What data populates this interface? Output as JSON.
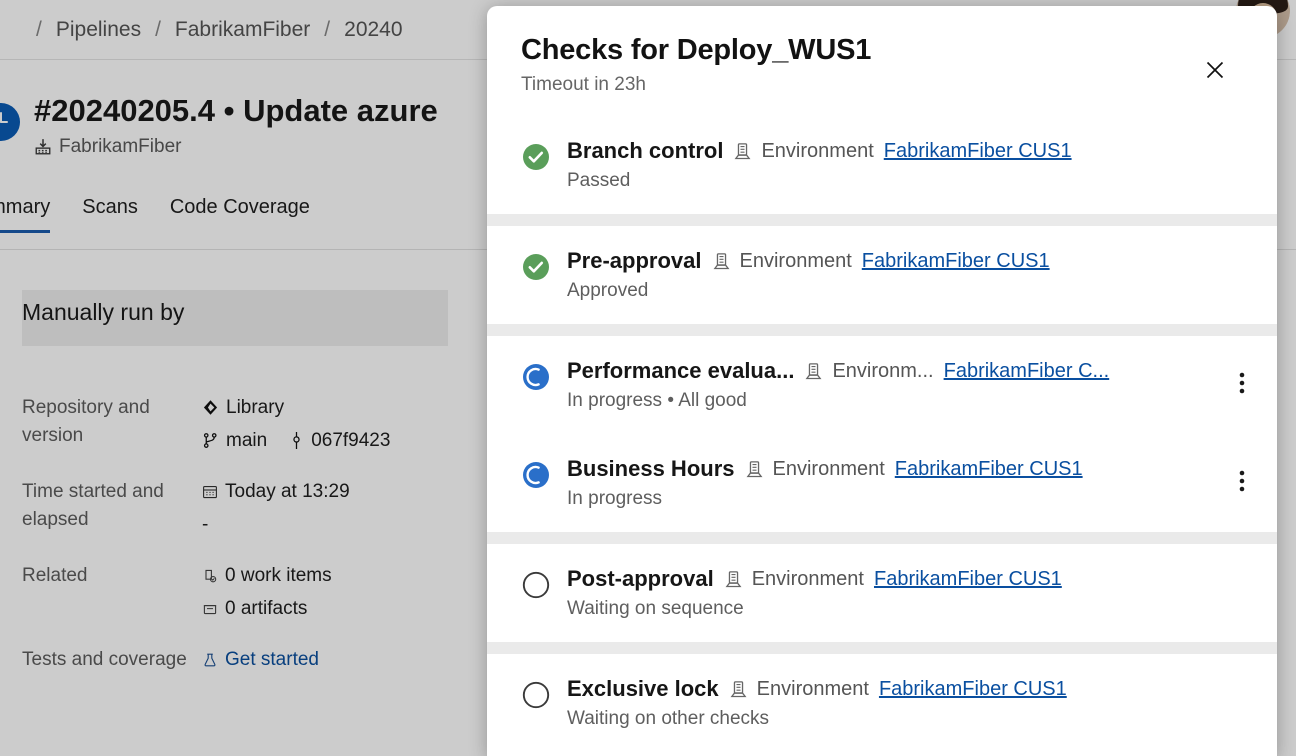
{
  "background": {
    "breadcrumb": {
      "separator": "/",
      "items": [
        "Pipelines",
        "FabrikamFiber",
        "20240"
      ]
    },
    "run": {
      "status_icon": "clock-icon",
      "title": "#20240205.4 • Update azure",
      "pipeline_icon": "pipeline-icon",
      "pipeline_name": "FabrikamFiber"
    },
    "tabs": [
      {
        "label": "ummary",
        "active": true
      },
      {
        "label": "Scans",
        "active": false
      },
      {
        "label": "Code Coverage",
        "active": false
      }
    ],
    "manually_run_by": "Manually run by",
    "details": [
      {
        "label": "Repository and version",
        "lines": [
          {
            "icon": "repository-icon",
            "text": "Library",
            "link": false
          },
          {
            "icon": "branch-icon",
            "text": "main",
            "link": false,
            "second_icon": "commit-icon",
            "second_text": "067f9423"
          }
        ]
      },
      {
        "label": "Time started and elapsed",
        "lines": [
          {
            "icon": "calendar-icon",
            "text": "Today at 13:29",
            "link": false
          },
          {
            "icon": "",
            "text": "-",
            "link": false
          }
        ]
      },
      {
        "label": "Related",
        "lines": [
          {
            "icon": "work-item-icon",
            "text": "0 work items",
            "link": false
          },
          {
            "icon": "artifact-icon",
            "text": "0 artifacts",
            "link": false
          }
        ]
      },
      {
        "label": "Tests and coverage",
        "lines": [
          {
            "icon": "flask-icon",
            "text": "Get started",
            "link": true
          }
        ]
      }
    ],
    "avatar": "user-avatar"
  },
  "dialog": {
    "title": "Checks for Deploy_WUS1",
    "subtitle": "Timeout in 23h",
    "close_icon": "close-icon",
    "checks": [
      {
        "status_icon": "success-icon",
        "name": "Branch control",
        "environment_icon": "environment-icon",
        "environment_label": "Environment",
        "environment_link": "FabrikamFiber CUS1",
        "status_text": "Passed",
        "has_more_menu": false,
        "separator_after": true
      },
      {
        "status_icon": "success-icon",
        "name": "Pre-approval",
        "environment_icon": "environment-icon",
        "environment_label": "Environment",
        "environment_link": "FabrikamFiber CUS1",
        "status_text": "Approved",
        "has_more_menu": false,
        "separator_after": true
      },
      {
        "status_icon": "in-progress-icon",
        "name": "Performance evalua...",
        "environment_icon": "environment-icon",
        "environment_label": "Environm...",
        "environment_link": "FabrikamFiber C...",
        "status_text": "In progress • All good",
        "has_more_menu": true,
        "separator_after": false
      },
      {
        "status_icon": "in-progress-icon",
        "name": "Business Hours",
        "environment_icon": "environment-icon",
        "environment_label": "Environment",
        "environment_link": "FabrikamFiber CUS1",
        "status_text": "In progress",
        "has_more_menu": true,
        "separator_after": true
      },
      {
        "status_icon": "pending-icon",
        "name": "Post-approval",
        "environment_icon": "environment-icon",
        "environment_label": "Environment",
        "environment_link": "FabrikamFiber CUS1",
        "status_text": "Waiting on sequence",
        "has_more_menu": false,
        "separator_after": true
      },
      {
        "status_icon": "pending-icon",
        "name": "Exclusive lock",
        "environment_icon": "environment-icon",
        "environment_label": "Environment",
        "environment_link": "FabrikamFiber CUS1",
        "status_text": "Waiting on other checks",
        "has_more_menu": false,
        "separator_after": false
      }
    ]
  },
  "colors": {
    "success": "#5a9e5a",
    "in_progress": "#2a6fc9",
    "pending": "#3a3a3a",
    "link": "#0a4fa0",
    "accent": "#1b5cad"
  }
}
